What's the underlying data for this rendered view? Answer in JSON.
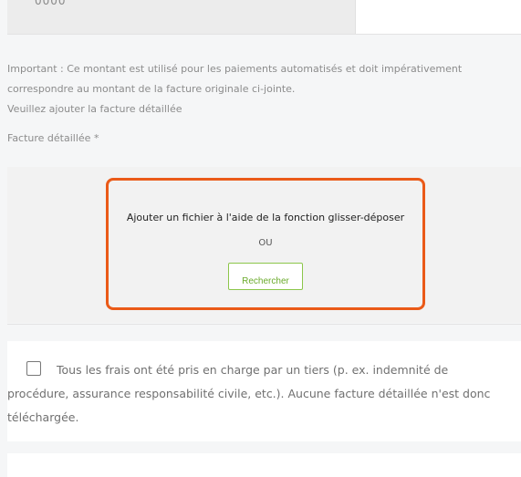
{
  "amount_field": {
    "value": "0000"
  },
  "help": {
    "important": "Important : Ce montant est utilisé pour les paiements automatisés et doit impérativement correspondre au montant de la facture originale ci-jointe.",
    "add_invoice": "Veuillez ajouter la facture détaillée"
  },
  "upload": {
    "label": "Facture détaillée *",
    "drop_text": "Ajouter un fichier à l'aide de la fonction glisser-déposer",
    "or_text": "OU",
    "browse_label": "Rechercher",
    "highlight_color": "#ea5a18",
    "button_color": "#6aaa2b"
  },
  "third_party": {
    "checked": false,
    "label": "Tous les frais ont été pris en charge par un tiers (p. ex. indemnité de procédure, assurance responsabilité civile, etc.). Aucune facture détaillée n'est donc téléchargée."
  }
}
